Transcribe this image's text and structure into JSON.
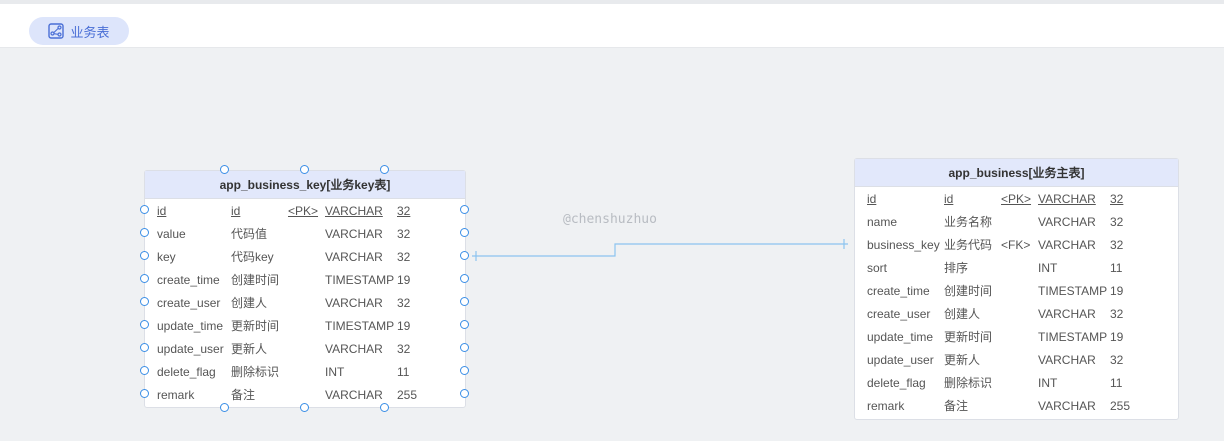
{
  "tab": {
    "label": "业务表",
    "icon": "diagram-icon"
  },
  "watermark": "@chenshuzhuo",
  "colors": {
    "accent": "#3a8ee6",
    "header_bg": "#e2e8fb",
    "link": "#8cc4f0"
  },
  "entities": [
    {
      "title": "app_business_key[业务key表]",
      "rows": [
        {
          "name": "id",
          "comment": "id",
          "key": "<PK>",
          "type": "VARCHAR",
          "length": "32"
        },
        {
          "name": "value",
          "comment": "代码值",
          "key": "",
          "type": "VARCHAR",
          "length": "32"
        },
        {
          "name": "key",
          "comment": "代码key",
          "key": "",
          "type": "VARCHAR",
          "length": "32"
        },
        {
          "name": "create_time",
          "comment": "创建时间",
          "key": "",
          "type": "TIMESTAMP",
          "length": "19"
        },
        {
          "name": "create_user",
          "comment": "创建人",
          "key": "",
          "type": "VARCHAR",
          "length": "32"
        },
        {
          "name": "update_time",
          "comment": "更新时间",
          "key": "",
          "type": "TIMESTAMP",
          "length": "19"
        },
        {
          "name": "update_user",
          "comment": "更新人",
          "key": "",
          "type": "VARCHAR",
          "length": "32"
        },
        {
          "name": "delete_flag",
          "comment": "删除标识",
          "key": "",
          "type": "INT",
          "length": "11"
        },
        {
          "name": "remark",
          "comment": "备注",
          "key": "",
          "type": "VARCHAR",
          "length": "255"
        }
      ]
    },
    {
      "title": "app_business[业务主表]",
      "rows": [
        {
          "name": "id",
          "comment": "id",
          "key": "<PK>",
          "type": "VARCHAR",
          "length": "32"
        },
        {
          "name": "name",
          "comment": "业务名称",
          "key": "",
          "type": "VARCHAR",
          "length": "32"
        },
        {
          "name": "business_key",
          "comment": "业务代码",
          "key": "<FK>",
          "type": "VARCHAR",
          "length": "32"
        },
        {
          "name": "sort",
          "comment": "排序",
          "key": "",
          "type": "INT",
          "length": "11"
        },
        {
          "name": "create_time",
          "comment": "创建时间",
          "key": "",
          "type": "TIMESTAMP",
          "length": "19"
        },
        {
          "name": "create_user",
          "comment": "创建人",
          "key": "",
          "type": "VARCHAR",
          "length": "32"
        },
        {
          "name": "update_time",
          "comment": "更新时间",
          "key": "",
          "type": "TIMESTAMP",
          "length": "19"
        },
        {
          "name": "update_user",
          "comment": "更新人",
          "key": "",
          "type": "VARCHAR",
          "length": "32"
        },
        {
          "name": "delete_flag",
          "comment": "删除标识",
          "key": "",
          "type": "INT",
          "length": "11"
        },
        {
          "name": "remark",
          "comment": "备注",
          "key": "",
          "type": "VARCHAR",
          "length": "255"
        }
      ]
    }
  ]
}
